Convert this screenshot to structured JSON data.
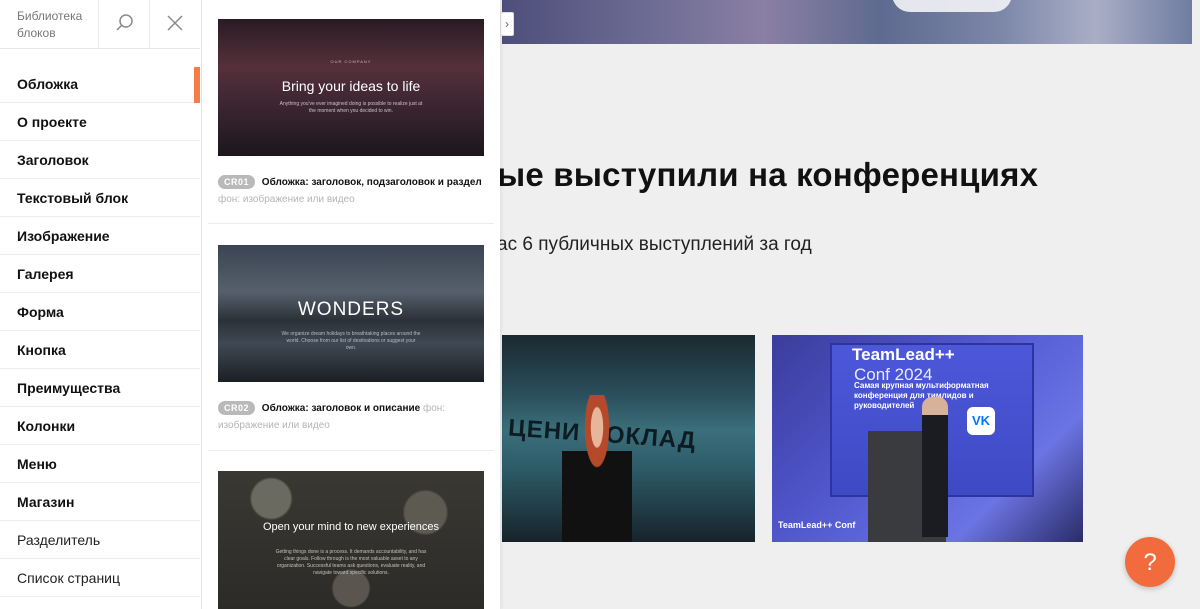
{
  "sidebar": {
    "title": "Библиотека блоков",
    "search_icon": "search-icon",
    "close_icon": "close-icon",
    "items": [
      {
        "label": "Обложка",
        "active": true
      },
      {
        "label": "О проекте"
      },
      {
        "label": "Заголовок"
      },
      {
        "label": "Текстовый блок"
      },
      {
        "label": "Изображение"
      },
      {
        "label": "Галерея"
      },
      {
        "label": "Форма"
      },
      {
        "label": "Кнопка"
      },
      {
        "label": "Преимущества"
      },
      {
        "label": "Колонки"
      },
      {
        "label": "Меню"
      },
      {
        "label": "Магазин"
      },
      {
        "label": "Разделитель"
      },
      {
        "label": "Список страниц"
      }
    ],
    "accent_color": "#f57b49"
  },
  "blocks": [
    {
      "code": "CR01",
      "name": "Обложка: заголовок, подзаголовок и раздел",
      "background": "фон: изображение или видео",
      "preview": {
        "eyebrow": "OUR COMPANY",
        "title": "Bring your ideas to life",
        "text": "Anything you've ever imagined doing is possible to realize just at the moment when you decided to win."
      }
    },
    {
      "code": "CR02",
      "name": "Обложка: заголовок и описание",
      "background": "фон: изображение или видео",
      "preview": {
        "title": "WONDERS",
        "text": "We organize dream holidays to breathtaking places around the world. Choose from our list of destinations or suggest your own."
      }
    },
    {
      "preview": {
        "title": "Open your mind to new experiences",
        "text": "Getting things done is a process. It demands accountability, and has clear goals. Follow through is the most valuable asset to any organization. Successful teams ask questions, evaluate reality, and navigate toward specific solutions."
      }
    }
  ],
  "page": {
    "heading": "ые выступили на конференциях",
    "subheading": "ас 6 публичных выступлений за год",
    "photo1_wall_text": "ЦЕНИ ДОКЛАД",
    "photo2": {
      "screen_title": "TeamLead++",
      "screen_sub": "Conf 2024",
      "screen_desc": "Самая крупная мультиформатная конференция для тимлидов и руководителей",
      "vk": "VK",
      "footer": "TeamLead++ Conf"
    },
    "help_label": "?",
    "help_color": "#f26b3c"
  }
}
